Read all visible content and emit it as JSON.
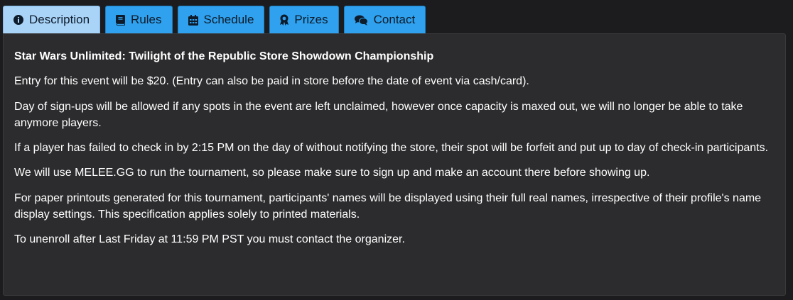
{
  "tabs": [
    {
      "label": "Description",
      "icon": "info-circle-icon",
      "active": true
    },
    {
      "label": "Rules",
      "icon": "book-icon",
      "active": false
    },
    {
      "label": "Schedule",
      "icon": "calendar-icon",
      "active": false
    },
    {
      "label": "Prizes",
      "icon": "award-icon",
      "active": false
    },
    {
      "label": "Contact",
      "icon": "comments-icon",
      "active": false
    }
  ],
  "description": {
    "title": "Star Wars Unlimited: Twilight of the Republic Store Showdown Championship",
    "paragraphs": [
      "Entry for this event will be $20. (Entry can also be paid in store before the date of event via cash/card).",
      "Day of sign-ups will be allowed if any spots in the event are left unclaimed, however once capacity is maxed out, we will no longer be able to take anymore players.",
      "If a player has failed to check in by 2:15 PM on the day of without notifying the store, their spot will be forfeit and put up to day of check-in participants.",
      "We will use MELEE.GG to run the tournament, so please make sure to sign up and make an account there before showing up.",
      "For paper printouts generated for this tournament, participants' names will be displayed using their full real names, irrespective of their profile's name display settings. This specification applies solely to printed materials.",
      "To unenroll after Last Friday at 11:59 PM PST you must contact the organizer."
    ]
  },
  "colors": {
    "tab_bg": "#2fa1ee",
    "tab_active_bg": "#a9d4f8",
    "panel_bg": "#2c2c2e",
    "page_bg": "#1c1c1e",
    "text": "#ffffff"
  }
}
